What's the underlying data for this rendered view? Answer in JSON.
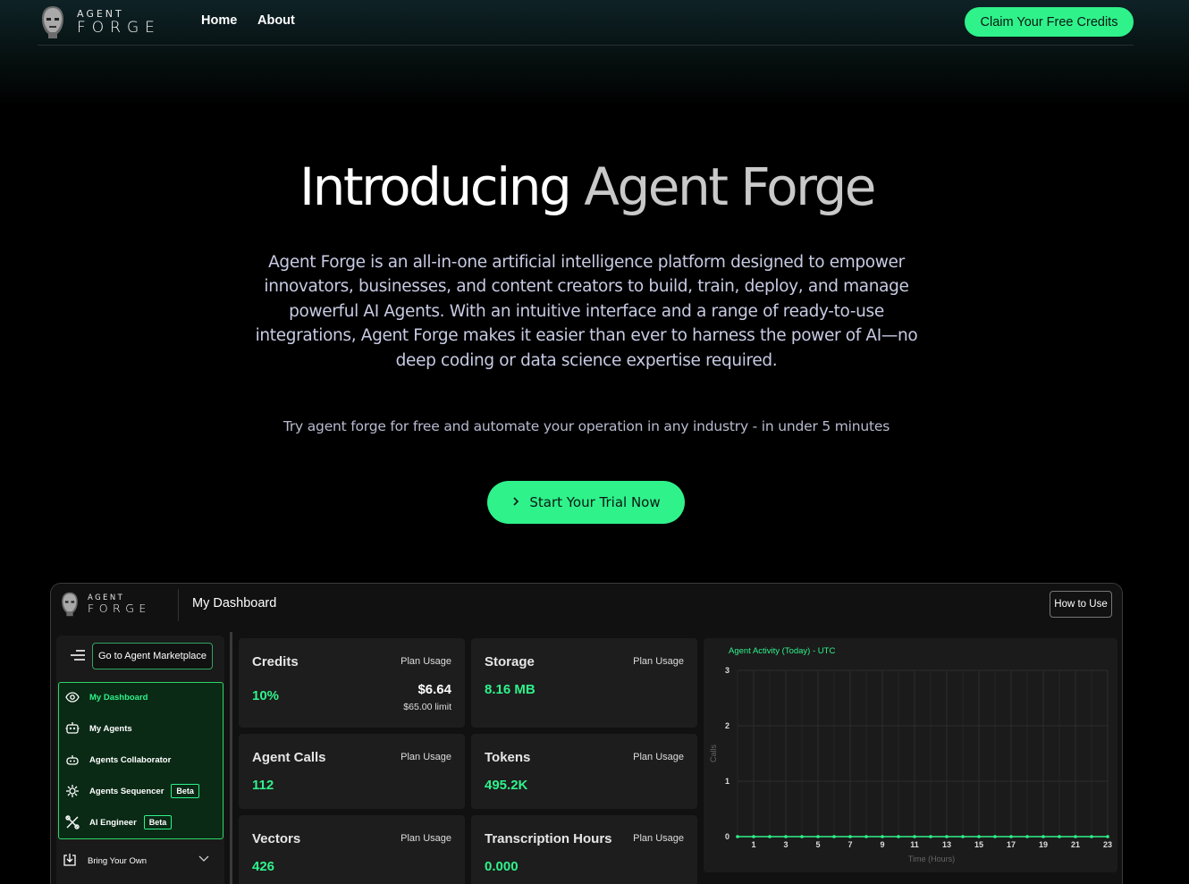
{
  "nav": {
    "logo_top": "AGENT",
    "logo_bottom": "FORGE",
    "links": [
      "Home",
      "About"
    ],
    "cta": "Claim Your Free Credits"
  },
  "hero": {
    "title_part1": "Introducing",
    "title_part2": "Agent Forge",
    "description": "Agent Forge is an all-in-one artificial intelligence platform designed to empower innovators, businesses, and content creators to build, train, deploy, and manage powerful AI Agents. With an intuitive interface and a range of ready-to-use integrations, Agent Forge makes it easier than ever to harness the power of AI—no deep coding or data science expertise required.",
    "subtitle": "Try agent forge for free and automate your operation in any industry - in under 5 minutes",
    "cta": "Start Your Trial Now"
  },
  "dashboard": {
    "logo_top": "AGENT",
    "logo_bottom": "FORGE",
    "title": "My Dashboard",
    "how_to_use": "How to Use",
    "marketplace_button": "Go to Agent Marketplace",
    "menu": [
      {
        "label": "My Dashboard",
        "icon": "eye-icon",
        "active": true
      },
      {
        "label": "My Agents",
        "icon": "robot-icon"
      },
      {
        "label": "Agents Collaborator",
        "icon": "bot-group-icon"
      },
      {
        "label": "Agents Sequencer",
        "icon": "gear-network-icon",
        "badge": "Beta"
      },
      {
        "label": "AI Engineer",
        "icon": "tools-icon",
        "badge": "Beta"
      }
    ],
    "bring_your_own": "Bring Your Own",
    "cards": {
      "credits": {
        "title": "Credits",
        "plan": "Plan Usage",
        "value": "10%",
        "amount": "$6.64",
        "limit": "$65.00 limit"
      },
      "storage": {
        "title": "Storage",
        "plan": "Plan Usage",
        "value": "8.16 MB"
      },
      "agent_calls": {
        "title": "Agent Calls",
        "plan": "Plan Usage",
        "value": "112"
      },
      "tokens": {
        "title": "Tokens",
        "plan": "Plan Usage",
        "value": "495.2K"
      },
      "vectors": {
        "title": "Vectors",
        "plan": "Plan Usage",
        "value": "426"
      },
      "transcription": {
        "title": "Transcription Hours",
        "plan": "Plan Usage",
        "value": "0.000"
      }
    }
  },
  "chart_data": {
    "type": "line",
    "title": "Agent Activity (Today) - UTC",
    "xlabel": "Time (Hours)",
    "ylabel": "Calls",
    "x": [
      0,
      1,
      2,
      3,
      4,
      5,
      6,
      7,
      8,
      9,
      10,
      11,
      12,
      13,
      14,
      15,
      16,
      17,
      18,
      19,
      20,
      21,
      22,
      23
    ],
    "x_tick_labels": [
      "1",
      "3",
      "5",
      "7",
      "9",
      "11",
      "13",
      "15",
      "17",
      "19",
      "21",
      "23"
    ],
    "y_tick_labels": [
      "0",
      "1",
      "2",
      "3"
    ],
    "series": [
      {
        "values": [
          0,
          0,
          0,
          0,
          0,
          0,
          0,
          0,
          0,
          0,
          0,
          0,
          0,
          0,
          0,
          0,
          0,
          0,
          0,
          0,
          0,
          0,
          0,
          0
        ]
      }
    ],
    "ylim": [
      0,
      3
    ],
    "grid": true,
    "line_color": "#2ff28b"
  }
}
